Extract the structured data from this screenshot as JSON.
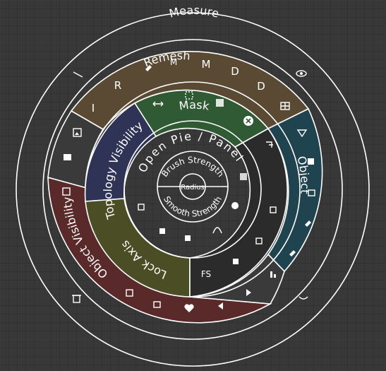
{
  "outer_title": "Measure",
  "segments": {
    "remesh": {
      "label": "Remesh",
      "letters": [
        "I",
        "R",
        "M",
        "M",
        "D",
        "D"
      ],
      "color": "#5b4a33"
    },
    "mask": {
      "label": "Mask",
      "color": "#2f5a33"
    },
    "object": {
      "label": "Object",
      "color": "#1f4450"
    },
    "object_visibility": {
      "label": "Object Visibility",
      "color": "#5a2a2a"
    },
    "topology_visibility": {
      "label": "Topology Visibility",
      "color": "#2f3355"
    },
    "lock_axis": {
      "label": "Lock Axis",
      "color": "#4b4e25"
    },
    "open_pie": {
      "label": "Open Pie / Panel",
      "color": "#2e2e2e"
    },
    "fs": {
      "label": "FS"
    }
  },
  "center": {
    "brush_strength": "Brush Strength",
    "smooth_strength": "Smooth Strength",
    "radius": "Radius"
  },
  "icons": [
    "ruler-icon",
    "pin-icon",
    "eye-icon",
    "arrows-horizontal-icon",
    "mask-select-icon",
    "gradient-icon",
    "close-circle-icon",
    "grid-icon",
    "image-icon",
    "box-icon",
    "select-icon",
    "triangle-down-icon",
    "crop-icon",
    "duplicate-icon",
    "shape-icon",
    "dropper-icon",
    "pipette-icon",
    "bars-icon",
    "curve-icon",
    "trash-icon",
    "heart-icon",
    "arrow-left-icon",
    "arrow-right-icon",
    "lock-icon",
    "chart-icon",
    "checker-icon",
    "pen-icon"
  ]
}
